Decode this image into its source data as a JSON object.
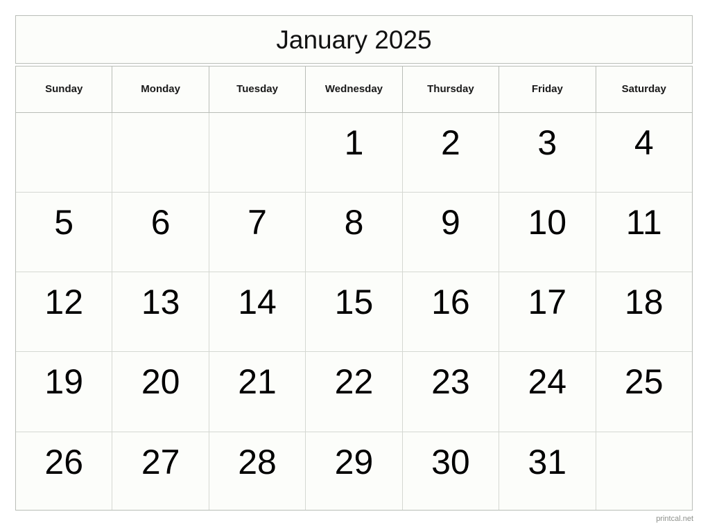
{
  "calendar": {
    "title": "January 2025",
    "month": "January",
    "year": "2025",
    "weekday_headers": [
      "Sunday",
      "Monday",
      "Tuesday",
      "Wednesday",
      "Thursday",
      "Friday",
      "Saturday"
    ],
    "weeks": [
      [
        "",
        "",
        "",
        "1",
        "2",
        "3",
        "4"
      ],
      [
        "5",
        "6",
        "7",
        "8",
        "9",
        "10",
        "11"
      ],
      [
        "12",
        "13",
        "14",
        "15",
        "16",
        "17",
        "18"
      ],
      [
        "19",
        "20",
        "21",
        "22",
        "23",
        "24",
        "25"
      ],
      [
        "26",
        "27",
        "28",
        "29",
        "30",
        "31",
        ""
      ]
    ],
    "footer": {
      "watermark": "printcal.net"
    },
    "colors": {
      "page_background": "#ffffff",
      "cell_background": "#fcfdfa",
      "outer_border": "#b9bdb7",
      "inner_gridline": "#d5d8d2",
      "title_text": "#111111",
      "header_text": "#1a1a1a",
      "day_number_text": "#000000",
      "watermark_text": "#8d908b"
    }
  }
}
